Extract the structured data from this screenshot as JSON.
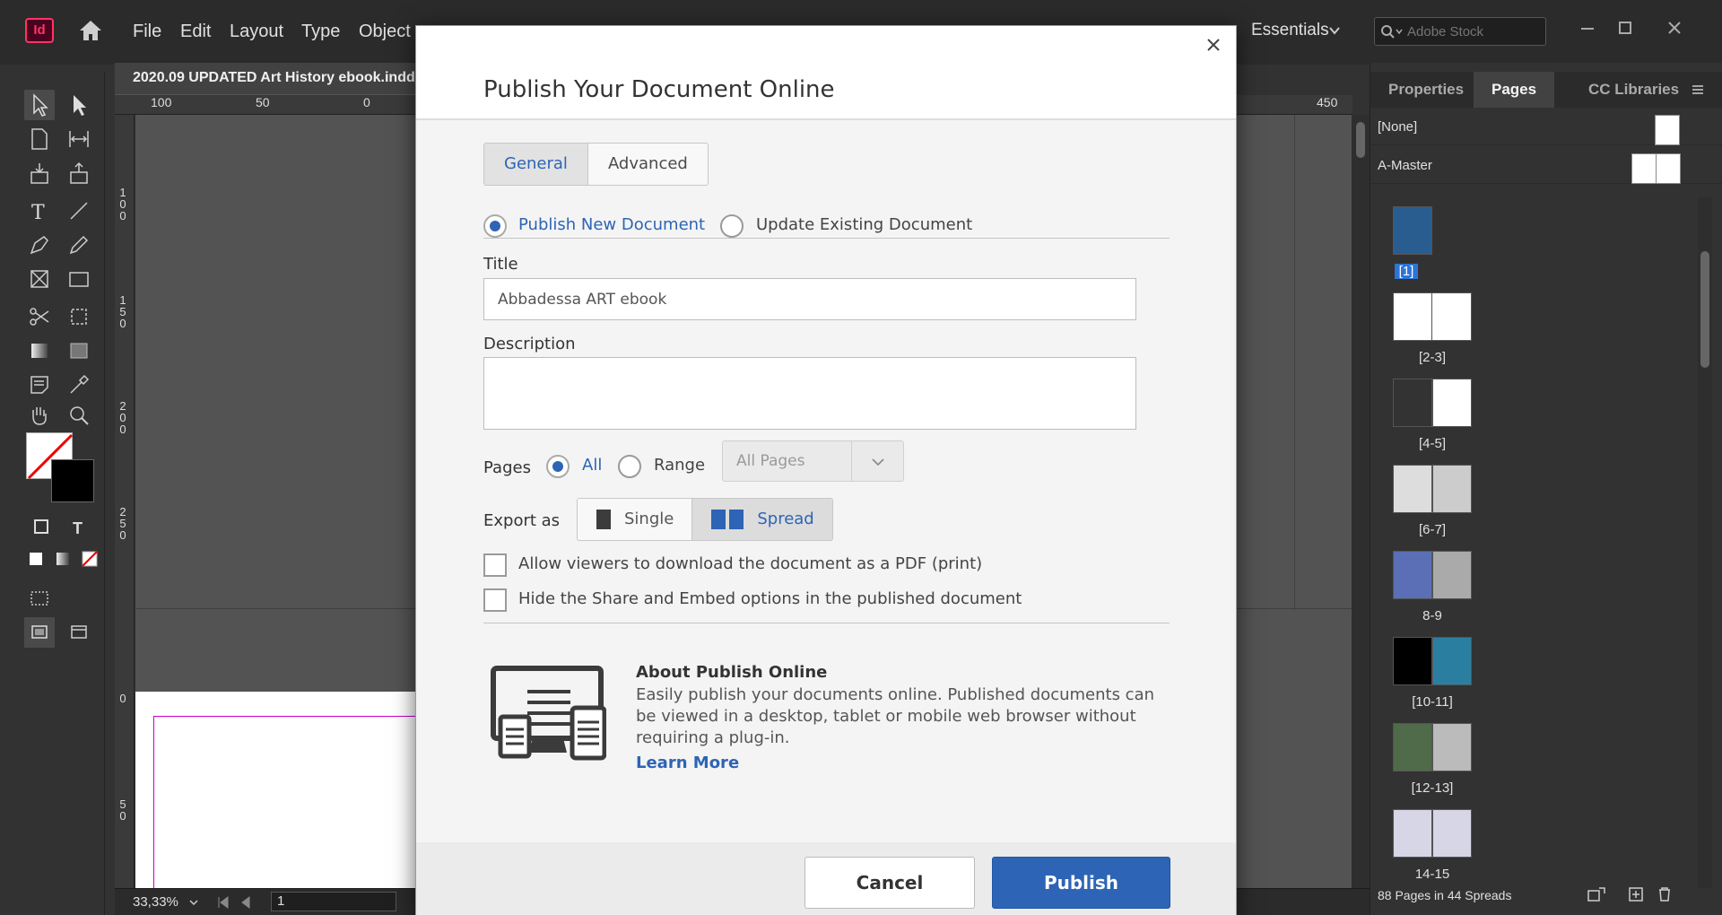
{
  "app": {
    "logo_text": "Id",
    "brand_color": "#ff3366"
  },
  "menu": {
    "items": [
      "File",
      "Edit",
      "Layout",
      "Type",
      "Object"
    ]
  },
  "workspace": {
    "label": "Essentials"
  },
  "search": {
    "placeholder": "Adobe Stock"
  },
  "document": {
    "tab_title": "2020.09 UPDATED Art History ebook.indd",
    "ruler_h": [
      "100",
      "50",
      "0",
      "450"
    ],
    "ruler_v": [
      [
        "1",
        "0",
        "0"
      ],
      [
        "1",
        "5",
        "0"
      ],
      [
        "2",
        "0",
        "0"
      ],
      [
        "2",
        "5",
        "0"
      ],
      [
        "0"
      ],
      [
        "5",
        "0"
      ]
    ]
  },
  "status": {
    "zoom": "33,33%",
    "page": "1"
  },
  "panel": {
    "tabs": [
      "Properties",
      "Pages",
      "CC Libraries"
    ],
    "active_tab": "Pages",
    "masters": [
      "[None]",
      "A-Master"
    ],
    "spreads": [
      "[1]",
      "[2-3]",
      "[4-5]",
      "[6-7]",
      "8-9",
      "[10-11]",
      "[12-13]",
      "14-15"
    ],
    "status": "88 Pages in 44 Spreads"
  },
  "dialog": {
    "title": "Publish Your Document Online",
    "tabs": [
      "General",
      "Advanced"
    ],
    "mode_new": "Publish New Document",
    "mode_update": "Update Existing Document",
    "title_label": "Title",
    "title_value": "Abbadessa ART ebook",
    "description_label": "Description",
    "description_value": "",
    "pages_label": "Pages",
    "pages_all": "All",
    "pages_range": "Range",
    "pages_select": "All Pages",
    "export_label": "Export as",
    "export_single": "Single",
    "export_spread": "Spread",
    "check_pdf": "Allow viewers to download the document as a PDF (print)",
    "check_share": "Hide the Share and Embed options in the published document",
    "about_title": "About Publish Online",
    "about_text": "Easily publish your documents online. Published documents can be viewed in a desktop, tablet or mobile web browser without requiring a plug-in.",
    "learn_more": "Learn More",
    "cancel": "Cancel",
    "publish": "Publish",
    "accent_color": "#2d64b5"
  }
}
